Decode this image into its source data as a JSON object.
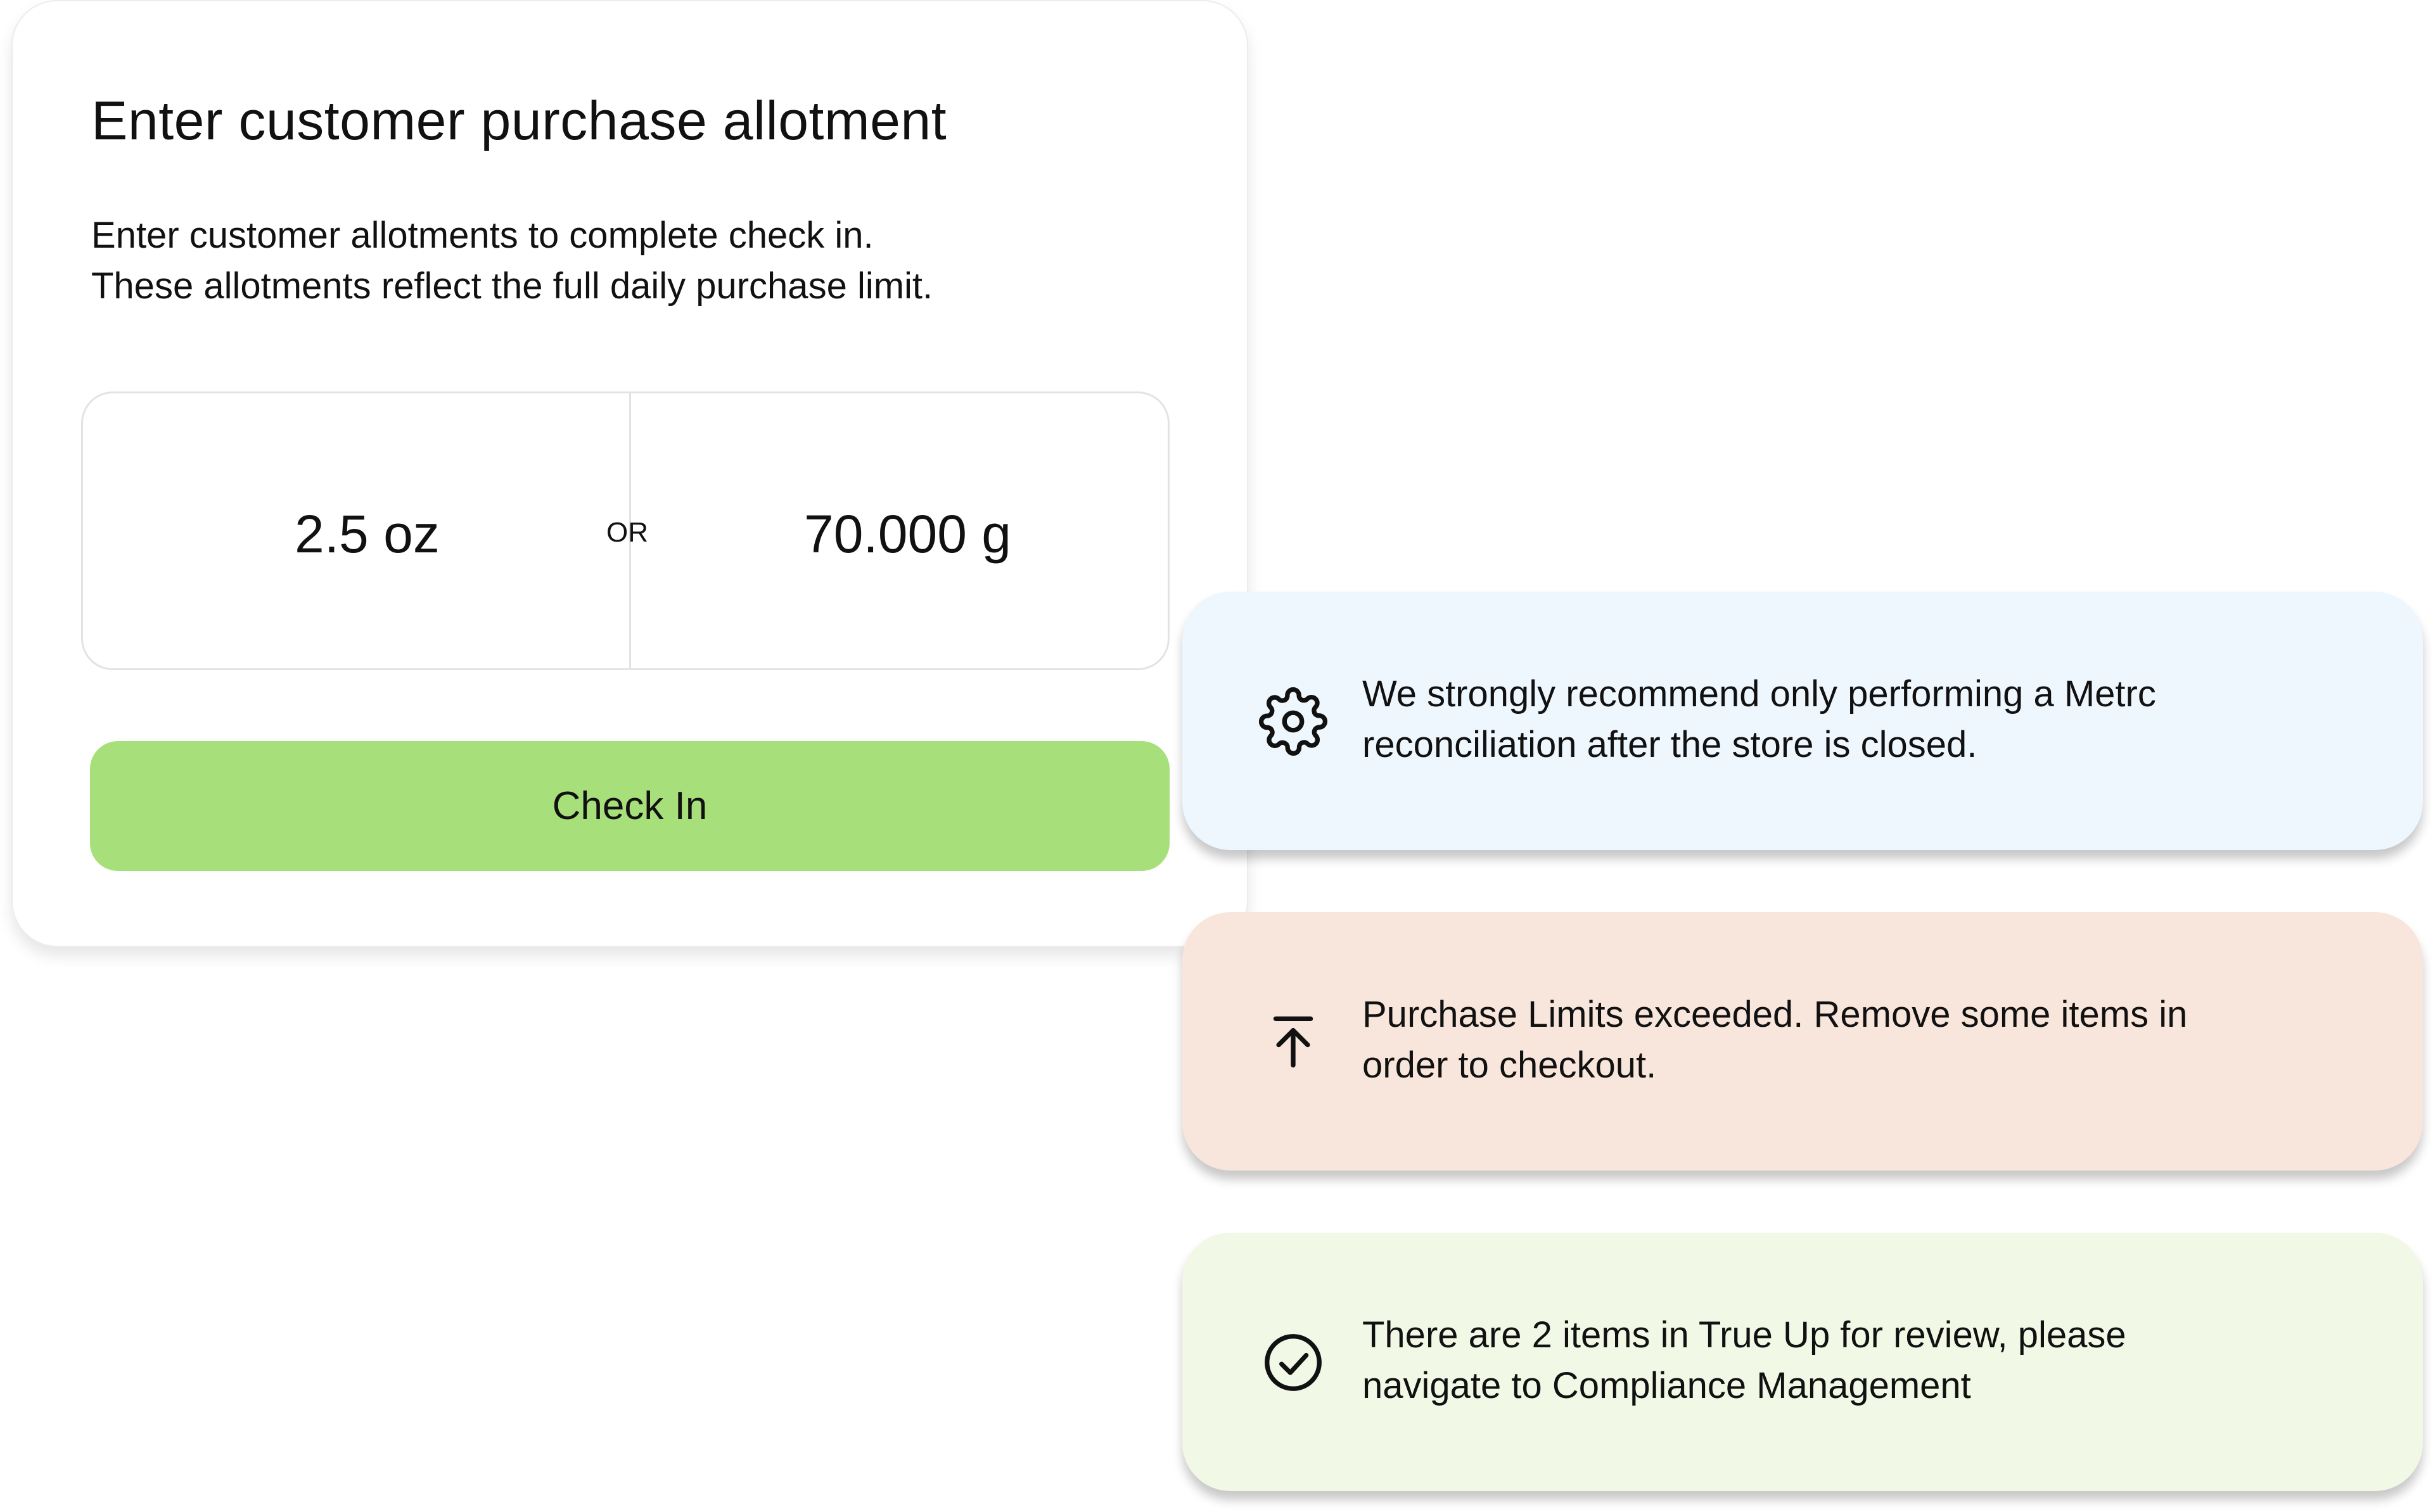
{
  "card": {
    "title": "Enter customer purchase allotment",
    "description_line1": "Enter customer allotments to complete check in.",
    "description_line2": "These allotments reflect the full daily purchase limit.",
    "allotment_oz": "2.5 oz",
    "separator": "OR",
    "allotment_g": "70.000 g",
    "button_label": "Check In",
    "button_color": "#a7e07a"
  },
  "notices": [
    {
      "icon": "gear-icon",
      "line1": "We strongly recommend only performing a Metrc",
      "line2": "reconciliation after the store is closed.",
      "background": "#eef6fe"
    },
    {
      "icon": "arrow-up-to-bar-icon",
      "line1": "Purchase Limits exceeded. Remove some items in",
      "line2": "order to checkout.",
      "background": "#f8e6dc"
    },
    {
      "icon": "check-circle-icon",
      "line1": "There are 2 items in True Up for review, please",
      "line2": "navigate to Compliance Management",
      "background": "#f1f8e6"
    }
  ]
}
